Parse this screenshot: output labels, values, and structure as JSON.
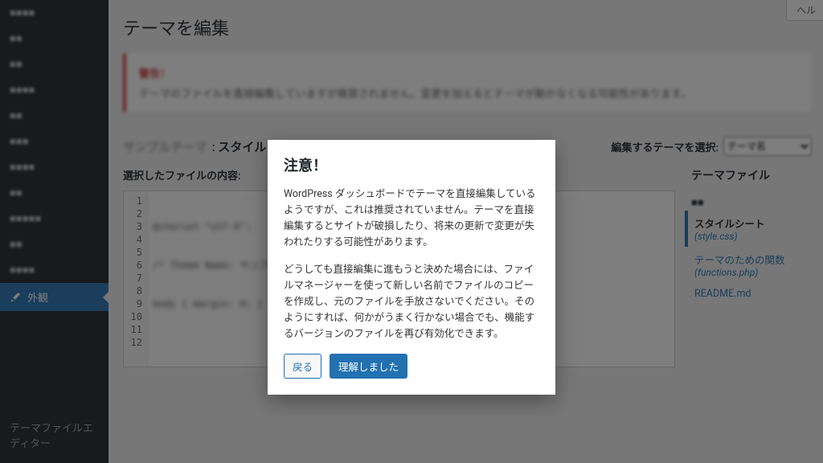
{
  "sidebar": {
    "items": [
      {
        "label": ""
      },
      {
        "label": ""
      },
      {
        "label": ""
      },
      {
        "label": ""
      },
      {
        "label": ""
      },
      {
        "label": ""
      },
      {
        "label": ""
      },
      {
        "label": ""
      },
      {
        "label": ""
      },
      {
        "label": ""
      },
      {
        "label": ""
      }
    ],
    "active_label": "外観",
    "editor_label": "テーマファイルエディター"
  },
  "header": {
    "help_label": "ヘル"
  },
  "page": {
    "title": "テーマを編集",
    "notice_title": "警告！",
    "notice_body": "テーマのファイルを直接編集していますが推奨されません。変更を加えるとテーマが動かなくなる可能性があります。"
  },
  "edit_header": {
    "theme_name": "サンプルテーマ",
    "file_label": ": スタイルシート (style.css)",
    "select_label": "編集するテーマを選択:",
    "selected_theme": "テーマ名"
  },
  "editor": {
    "selected_file_label": "選択したファイルの内容:",
    "line_numbers": [
      "1",
      "2",
      "3",
      "4",
      "5",
      "6",
      "7",
      "8",
      "9",
      "10",
      "11",
      "12"
    ],
    "lines": [
      "@charset \"utf-8\";",
      "/* Theme Name: サンプルテーマ */",
      "body { margin: 0; }",
      "",
      "",
      "",
      "",
      "",
      "",
      "",
      "",
      ""
    ]
  },
  "files": {
    "title": "テーマファイル",
    "items": [
      {
        "label": "スタイルシート",
        "fname": "(style.css)",
        "active": true
      },
      {
        "label": "テーマのための関数",
        "fname": "(functions.php)",
        "active": false
      },
      {
        "label": "README.md",
        "fname": "",
        "active": false
      }
    ]
  },
  "modal": {
    "title": "注意！",
    "p1": "WordPress ダッシュボードでテーマを直接編集しているようですが、これは推奨されていません。テーマを直接編集するとサイトが破損したり、将来の更新で変更が失われたりする可能性があります。",
    "p2": "どうしても直接編集に進もうと決めた場合には、ファイルマネージャーを使って新しい名前でファイルのコピーを作成し、元のファイルを手放さないでください。そのようにすれば、何かがうまく行かない場合でも、機能するバージョンのファイルを再び有効化できます。",
    "back_label": "戻る",
    "ok_label": "理解しました"
  }
}
